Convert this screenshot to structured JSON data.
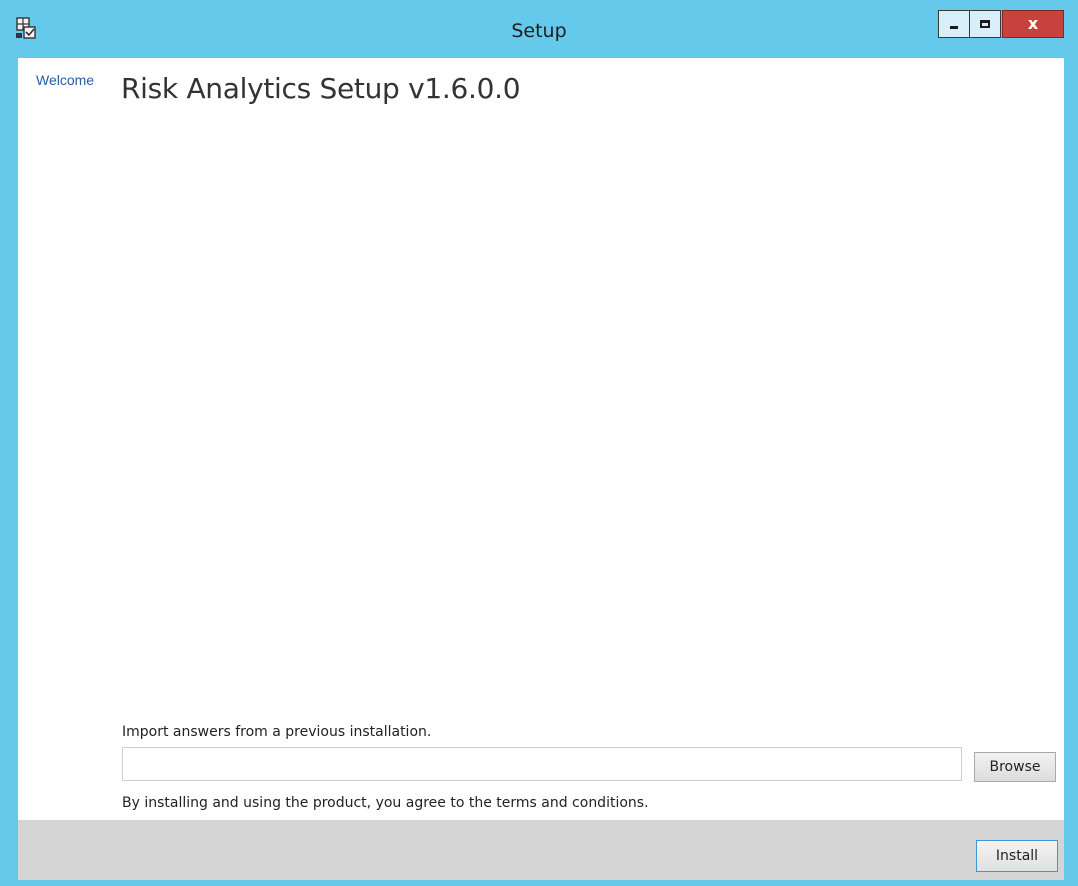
{
  "window": {
    "title": "Setup",
    "accent_color": "#65c9ec",
    "close_color": "#c9413c",
    "icons": {
      "app": "setup-app-icon",
      "minimize": "minimize-icon",
      "maximize": "maximize-icon",
      "close": "close-icon"
    },
    "close_glyph": "x"
  },
  "nav": {
    "items": [
      {
        "label": "Welcome",
        "active": true
      }
    ]
  },
  "main": {
    "title": "Risk Analytics Setup v1.6.0.0",
    "import_label": "Import answers from a previous installation.",
    "import_path_value": "",
    "browse_label": "Browse",
    "terms_text": "By installing and using the product, you agree to the terms and conditions."
  },
  "footer": {
    "install_label": "Install"
  }
}
